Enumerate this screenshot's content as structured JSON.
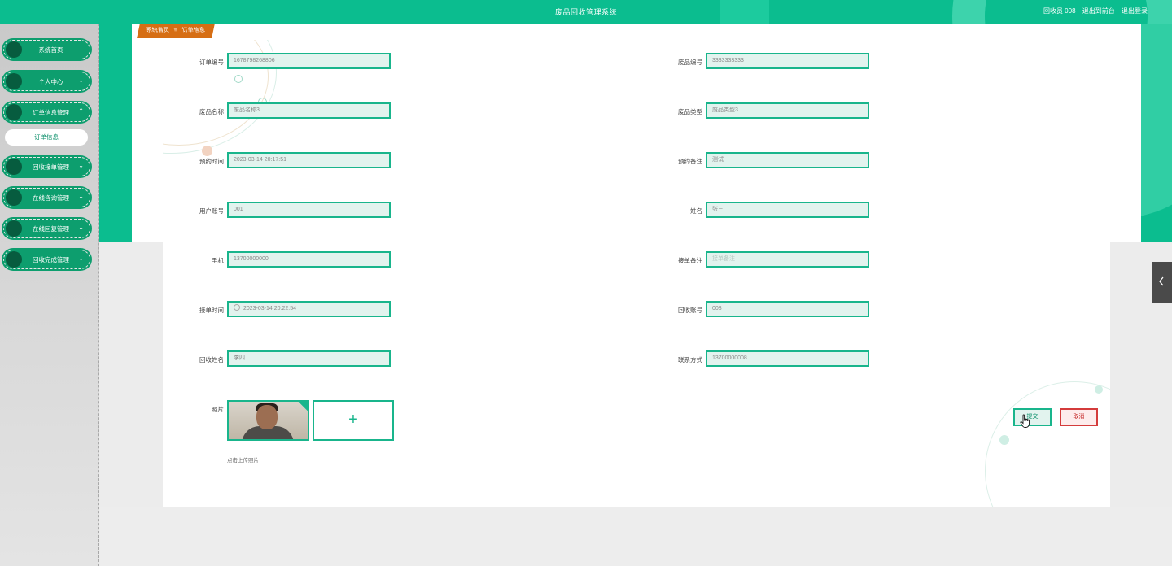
{
  "app": {
    "title": "废品回收管理系统"
  },
  "header": {
    "user_text": "回收员 008",
    "backend_link": "退出到前台",
    "logout_link": "退出登录"
  },
  "sidebar": {
    "items": [
      {
        "label": "系统首页",
        "chevron": ""
      },
      {
        "label": "个人中心",
        "chevron": "⌄"
      },
      {
        "label": "订单信息管理",
        "chevron": "⌃"
      },
      {
        "label": "回收接单管理",
        "chevron": "⌄"
      },
      {
        "label": "在线咨询管理",
        "chevron": "⌄"
      },
      {
        "label": "在线回复管理",
        "chevron": "⌄"
      },
      {
        "label": "回收完成管理",
        "chevron": "⌄"
      }
    ],
    "active_sub": "订单信息"
  },
  "breadcrumb": {
    "home": "系统首页",
    "separator": "≡",
    "current": "订单信息"
  },
  "form": {
    "order_no": {
      "label": "订单编号",
      "value": "1678798268806"
    },
    "waste_no": {
      "label": "废品编号",
      "value": "3333333333"
    },
    "waste_name": {
      "label": "废品名称",
      "value": "废品名称3"
    },
    "waste_type": {
      "label": "废品类型",
      "value": "废品类型3"
    },
    "appoint_time": {
      "label": "预约时间",
      "value": "2023-03-14 20:17:51"
    },
    "appoint_note": {
      "label": "预约备注",
      "value": "测试"
    },
    "user_account": {
      "label": "用户账号",
      "value": "001"
    },
    "name": {
      "label": "姓名",
      "value": "张三"
    },
    "phone": {
      "label": "手机",
      "value": "13700000000"
    },
    "accept_note": {
      "label": "接单备注",
      "placeholder": "接单备注"
    },
    "accept_time": {
      "label": "接单时间",
      "value": "2023-03-14 20:22:54"
    },
    "recycler_account": {
      "label": "回收账号",
      "value": "008"
    },
    "recycler_name": {
      "label": "回收姓名",
      "value": "李四"
    },
    "contact": {
      "label": "联系方式",
      "value": "13700000008"
    },
    "photo": {
      "label": "照片",
      "upload_symbol": "+",
      "tip": "点击上传照片"
    }
  },
  "buttons": {
    "submit": "提交",
    "cancel": "取消"
  },
  "colors": {
    "primary": "#0bbd8f",
    "sidebar_item": "#0d9e6e",
    "breadcrumb": "#d66e14",
    "cancel": "#d43b3b"
  },
  "icons": {
    "collapse_toggle": "chevron-left-icon",
    "pointer": "hand-pointer-icon",
    "time": "clock-icon"
  }
}
